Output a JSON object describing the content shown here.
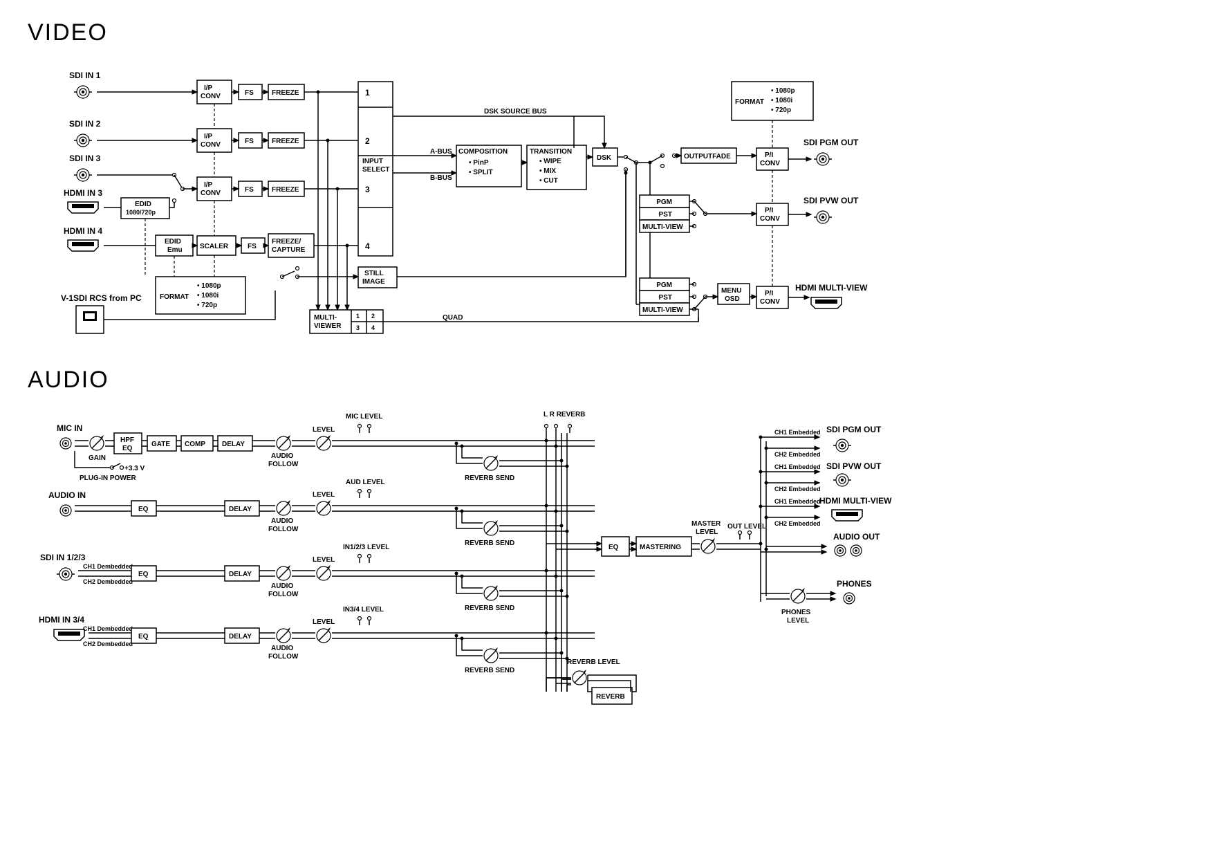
{
  "headings": {
    "video": "VIDEO",
    "audio": "AUDIO"
  },
  "video": {
    "inputs": [
      "SDI IN 1",
      "SDI IN 2",
      "SDI IN 3",
      "HDMI IN 3",
      "HDMI IN 4"
    ],
    "edid1": "EDID\n1080/720p",
    "edid2": "EDID\nEmu",
    "ipconv": "I/P\nCONV",
    "fs": "FS",
    "freeze": "FREEZE",
    "freezecap": "FREEZE/\nCAPTURE",
    "scaler": "SCALER",
    "format": "FORMAT",
    "format_list": [
      "• 1080p",
      "• 1080i",
      "• 720p"
    ],
    "rcs": "V-1SDI RCS from PC",
    "input_select": "INPUT\nSELECT",
    "input_nums": [
      "1",
      "2",
      "3",
      "4"
    ],
    "multiviewer": "MULTI-\nVIEWER",
    "still": "STILL\nIMAGE",
    "quad": "QUAD",
    "dsk_src": "DSK SOURCE BUS",
    "abus": "A-BUS",
    "bbus": "B-BUS",
    "composition": "COMPOSITION",
    "comp_list": [
      "• PinP",
      "• SPLIT"
    ],
    "transition": "TRANSITION",
    "trans_list": [
      "• WIPE",
      "• MIX",
      "• CUT"
    ],
    "dsk": "DSK",
    "outputfade": "OUTPUTFADE",
    "pviews": [
      "PGM",
      "PST",
      "MULTI-VIEW"
    ],
    "menu": "MENU\nOSD",
    "piconv": "P/I\nCONV",
    "outputs": [
      "SDI PGM OUT",
      "SDI PVW OUT",
      "HDMI MULTI-VIEW"
    ]
  },
  "audio": {
    "inputs": [
      "MIC IN",
      "AUDIO IN",
      "SDI IN 1/2/3",
      "HDMI IN 3/4"
    ],
    "gain": "GAIN",
    "plug": "PLUG-IN POWER",
    "v33": "+3.3 V",
    "hpfeq": "HPF\nEQ",
    "gate": "GATE",
    "comp": "COMP",
    "delay": "DELAY",
    "eq": "EQ",
    "afollow": "AUDIO\nFOLLOW",
    "level": "LEVEL",
    "mic_lvl": "MIC LEVEL",
    "aud_lvl": "AUD LEVEL",
    "in123": "IN1/2/3 LEVEL",
    "in34": "IN3/4 LEVEL",
    "revsend": "REVERB SEND",
    "lrrev": "L    R  REVERB",
    "mastering": "MASTERING",
    "master_lvl": "MASTER\nLEVEL",
    "out_lvl": "OUT LEVEL",
    "reverb": "REVERB",
    "rev_lvl": "REVERB LEVEL",
    "ch1emb": "CH1 Embedded",
    "ch2emb": "CH2 Embedded",
    "ch1demb": "CH1 Dembedded",
    "ch2demb": "CH2 Dembedded",
    "outputs": [
      "SDI PGM OUT",
      "SDI PVW OUT",
      "HDMI MULTI-VIEW",
      "AUDIO OUT",
      "PHONES"
    ],
    "phones_lvl": "PHONES\nLEVEL"
  }
}
